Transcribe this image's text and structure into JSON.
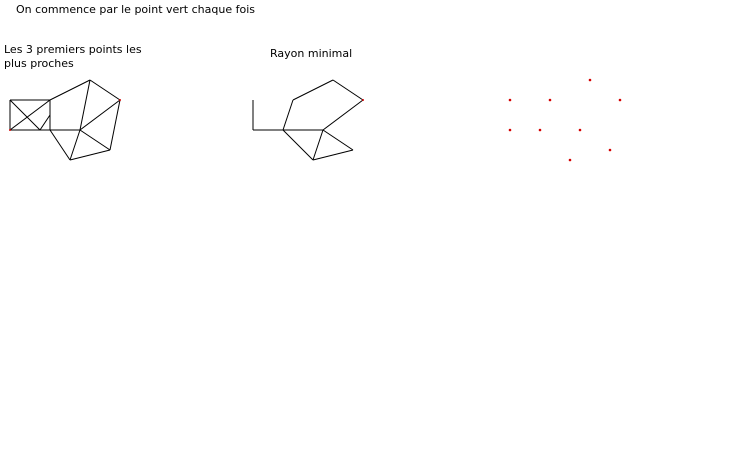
{
  "main_caption": "On commence par le point vert  chaque fois",
  "panels": {
    "nearest_three": {
      "caption": "Les 3 premiers points les\nplus proches"
    },
    "min_radius": {
      "caption": "Rayon minimal"
    },
    "points_only": {
      "caption": ""
    }
  },
  "colors": {
    "line": "#000000",
    "point": "#d40000"
  }
}
